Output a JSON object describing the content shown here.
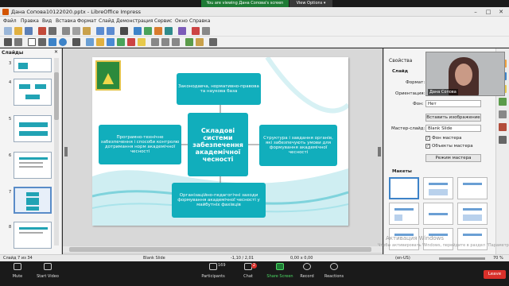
{
  "zoom_top": {
    "banner": "You are viewing Дана Сопова's screen",
    "view_options": "View Options ▾"
  },
  "window": {
    "title": "Дана Сопова10122020.pptx - LibreOffice Impress",
    "min": "–",
    "max": "□",
    "close": "✕"
  },
  "menu": [
    "Файл",
    "Правка",
    "Вид",
    "Вставка",
    "Формат",
    "Слайд",
    "Демонстрация",
    "Сервис",
    "Окно",
    "Справка"
  ],
  "slides_panel": {
    "title": "Слайды",
    "numbers": [
      "3",
      "4",
      "5",
      "6",
      "7",
      "8"
    ],
    "close": "✕"
  },
  "slide": {
    "top_box": "Законодавча, нормативно-правова та наукова база",
    "left_box": "Програмно-технічне забезпечення і способи контролю дотримання норм академічної чесності",
    "center_box": "Складові системи забезпечення академічної чесності",
    "right_box": "Структура і завдання органів, які забезпечують умови для формування академічної чесності",
    "bottom_box": "Організаційно-педагогічні заходи формування академічної чесності у майбутніх фахівців"
  },
  "sidebar": {
    "title": "Свойства",
    "section_slide": "Слайд",
    "format_label": "Формат:",
    "orientation_label": "Ориентация:",
    "background_label": "Фон:",
    "background_value": "Нет",
    "insert_image": "Вставить изображение",
    "master_label": "Мастер-слайд:",
    "master_value": "Blank Slide",
    "show_master_bg": "Фон мастера",
    "show_master_objects": "Объекты мастера",
    "master_mode": "Режим мастера",
    "section_layouts": "Макеты",
    "close": "✕"
  },
  "camera": {
    "name": "Дана Сопова"
  },
  "status": {
    "slide": "Слайд 7 из 34",
    "layout": "Blank Slide",
    "coords": "-1,10 / 2,01",
    "size": "0,00 x 0,00",
    "lang": "(en-US)",
    "zoom": "70 %"
  },
  "activation": {
    "title": "Активация Windows",
    "text": "Чтобы активировать Windows, перейдите в раздел \"Параметры\"."
  },
  "zoom_bar": {
    "mute": "Mute",
    "video": "Start Video",
    "participants": "Participants",
    "participants_count": "169",
    "chat": "Chat",
    "chat_count": "2",
    "share": "Share Screen",
    "record": "Record",
    "reactions": "Reactions",
    "leave": "Leave"
  },
  "colors": {
    "accent": "#11aebc",
    "share_green": "#1e7b35",
    "leave_red": "#d9302a"
  }
}
